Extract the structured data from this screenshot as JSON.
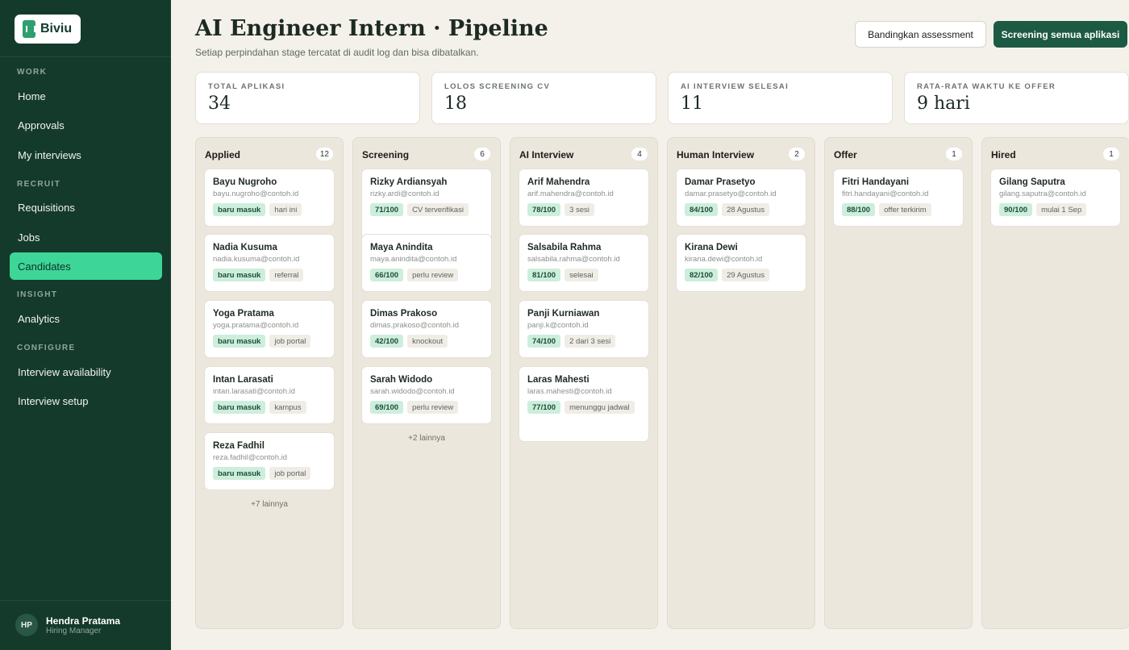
{
  "app": {
    "logo_text": "Biviu"
  },
  "sidebar": {
    "sections": [
      "WORK",
      "RECRUIT",
      "INSIGHT",
      "CONFIGURE"
    ],
    "items": [
      {
        "label": "Home"
      },
      {
        "label": "Approvals"
      },
      {
        "label": "My interviews"
      },
      {
        "label": "Requisitions"
      },
      {
        "label": "Jobs"
      },
      {
        "label": "Candidates"
      },
      {
        "label": "Analytics"
      },
      {
        "label": "Interview availability"
      },
      {
        "label": "Interview setup"
      }
    ],
    "active_item": "Candidates",
    "user": {
      "initials": "HP",
      "name": "Hendra Pratama",
      "role": "Hiring Manager"
    }
  },
  "header": {
    "title": "AI Engineer Intern · Pipeline",
    "subtitle": "Setiap perpindahan stage tercatat di audit log dan bisa dibatalkan.",
    "compare_button": "Bandingkan assessment",
    "screen_all_button": "Screening semua aplikasi"
  },
  "stats": [
    {
      "label": "TOTAL APLIKASI",
      "value": "34"
    },
    {
      "label": "LOLOS SCREENING CV",
      "value": "18"
    },
    {
      "label": "AI INTERVIEW SELESAI",
      "value": "11"
    },
    {
      "label": "RATA-RATA WAKTU KE OFFER",
      "value": "9 hari"
    }
  ],
  "columns": [
    {
      "title": "Applied",
      "count": "12",
      "more": "+7 lainnya",
      "cards": [
        {
          "name": "Bayu Nugroho",
          "email": "bayu.nugroho@contoh.id",
          "tag1": "baru masuk",
          "tag2": "hari ini"
        },
        {
          "name": "Nadia Kusuma",
          "email": "nadia.kusuma@contoh.id",
          "tag1": "baru masuk",
          "tag2": "referral"
        },
        {
          "name": "Yoga Pratama",
          "email": "yoga.pratama@contoh.id",
          "tag1": "baru masuk",
          "tag2": "job portal"
        },
        {
          "name": "Intan Larasati",
          "email": "intan.larasati@contoh.id",
          "tag1": "baru masuk",
          "tag2": "kampus"
        },
        {
          "name": "Reza Fadhil",
          "email": "reza.fadhil@contoh.id",
          "tag1": "baru masuk",
          "tag2": "job portal"
        }
      ]
    },
    {
      "title": "Screening",
      "count": "6",
      "more": "+2 lainnya",
      "cards": [
        {
          "name": "Rizky Ardiansyah",
          "email": "rizky.ardi@contoh.id",
          "tag1": "71/100",
          "tag2": "CV terverifikasi"
        },
        {
          "name": "Maya Anindita",
          "email": "maya.anindita@contoh.id",
          "tag1": "66/100",
          "tag2": "perlu review"
        },
        {
          "name": "Dimas Prakoso",
          "email": "dimas.prakoso@contoh.id",
          "tag1": "42/100",
          "tag2": "knockout"
        },
        {
          "name": "Sarah Widodo",
          "email": "sarah.widodo@contoh.id",
          "tag1": "69/100",
          "tag2": "perlu review"
        }
      ]
    },
    {
      "title": "AI Interview",
      "count": "4",
      "more": "",
      "cards": [
        {
          "name": "Arif Mahendra",
          "email": "arif.mahendra@contoh.id",
          "tag1": "78/100",
          "tag2": "3 sesi"
        },
        {
          "name": "Salsabila Rahma",
          "email": "salsabila.rahma@contoh.id",
          "tag1": "81/100",
          "tag2": "selesai"
        },
        {
          "name": "Panji Kurniawan",
          "email": "panji.k@contoh.id",
          "tag1": "74/100",
          "tag2": "2 dari 3 sesi"
        },
        {
          "name": "Laras Mahesti",
          "email": "laras.mahesti@contoh.id",
          "tag1": "77/100",
          "tag2": "menunggu jadwal"
        }
      ]
    },
    {
      "title": "Human Interview",
      "count": "2",
      "more": "",
      "cards": [
        {
          "name": "Damar Prasetyo",
          "email": "damar.prasetyo@contoh.id",
          "tag1": "84/100",
          "tag2": "28 Agustus"
        },
        {
          "name": "Kirana Dewi",
          "email": "kirana.dewi@contoh.id",
          "tag1": "82/100",
          "tag2": "29 Agustus"
        }
      ]
    },
    {
      "title": "Offer",
      "count": "1",
      "more": "",
      "cards": [
        {
          "name": "Fitri Handayani",
          "email": "fitri.handayani@contoh.id",
          "tag1": "88/100",
          "tag2": "offer terkirim"
        }
      ]
    },
    {
      "title": "Hired",
      "count": "1",
      "more": "",
      "cards": [
        {
          "name": "Gilang Saputra",
          "email": "gilang.saputra@contoh.id",
          "tag1": "90/100",
          "tag2": "mulai 1 Sep"
        }
      ]
    }
  ]
}
